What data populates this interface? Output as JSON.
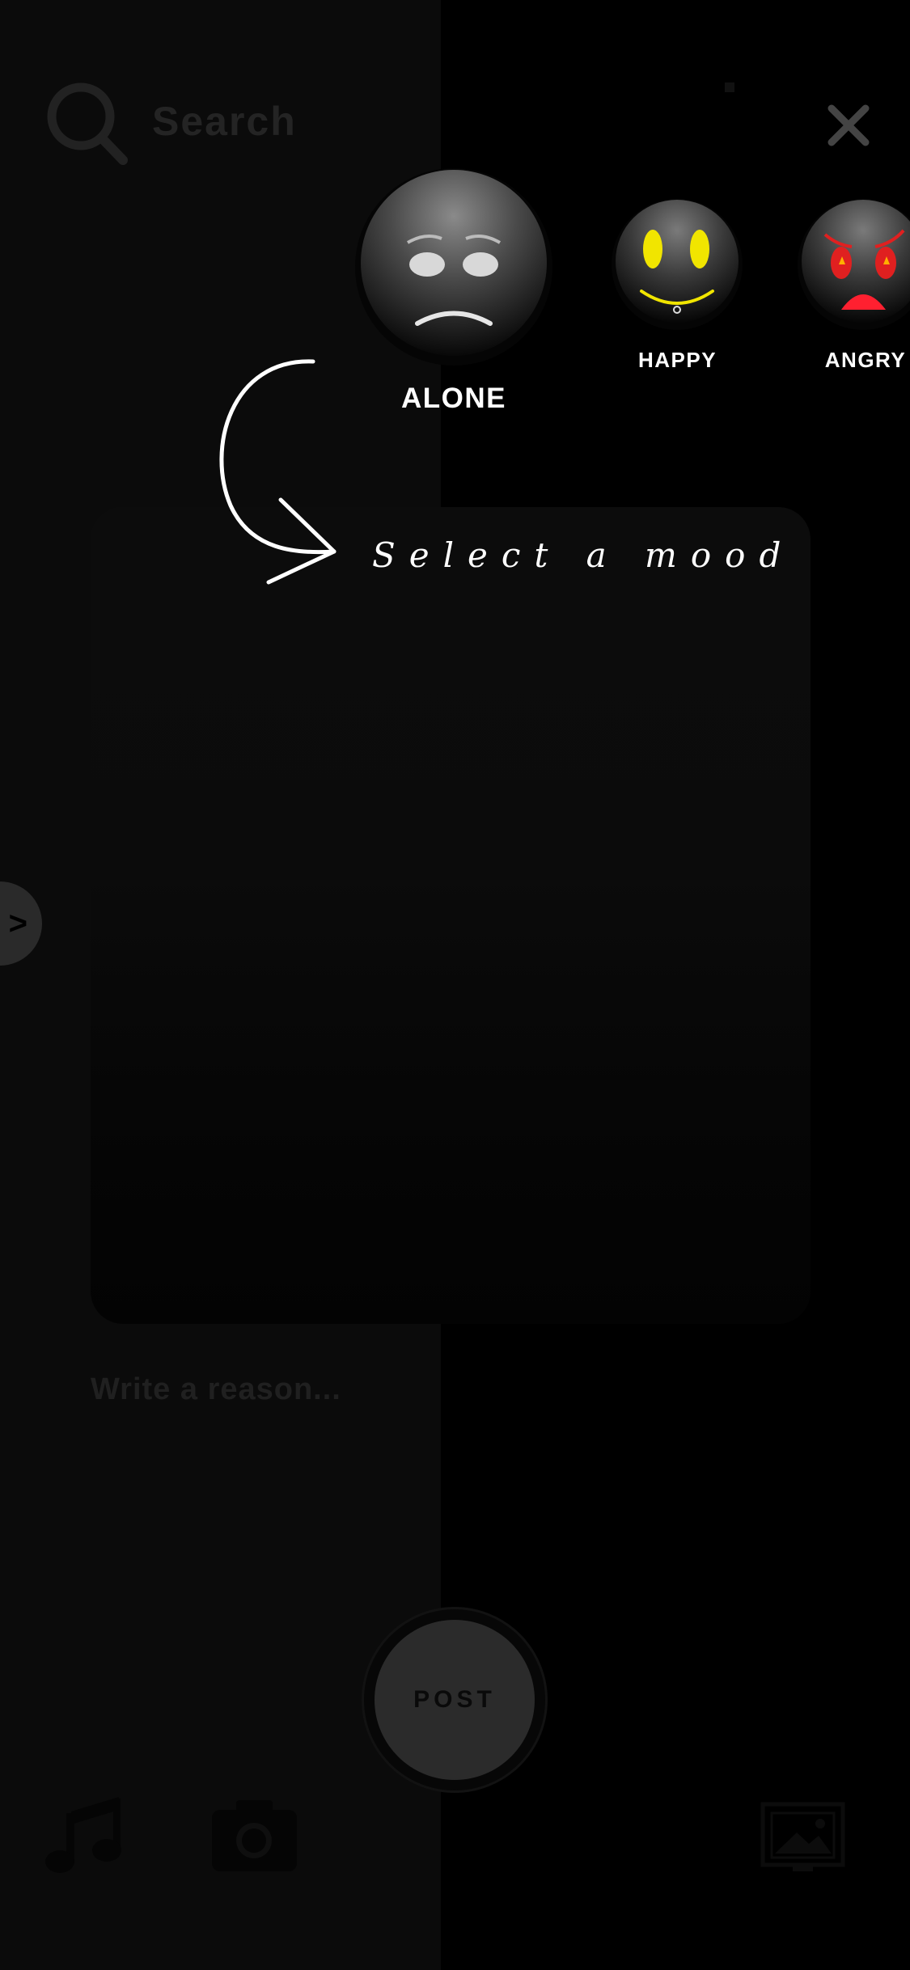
{
  "search": {
    "placeholder": "Search",
    "icon": "search-icon"
  },
  "moods": [
    {
      "label": "ALONE",
      "selected": true,
      "icon": "sad-face-icon"
    },
    {
      "label": "HAPPY",
      "selected": false,
      "icon": "happy-face-icon"
    },
    {
      "label": "ANGRY",
      "selected": false,
      "icon": "angry-face-icon"
    }
  ],
  "hint": {
    "text": "Select a mood"
  },
  "reason": {
    "placeholder": "Write a reason..."
  },
  "post": {
    "label": "POST"
  },
  "side_toggle": {
    "label": ">"
  },
  "colors": {
    "background": "#000000",
    "happy_accent": "#f1e500",
    "angry_accent": "#e02020"
  }
}
